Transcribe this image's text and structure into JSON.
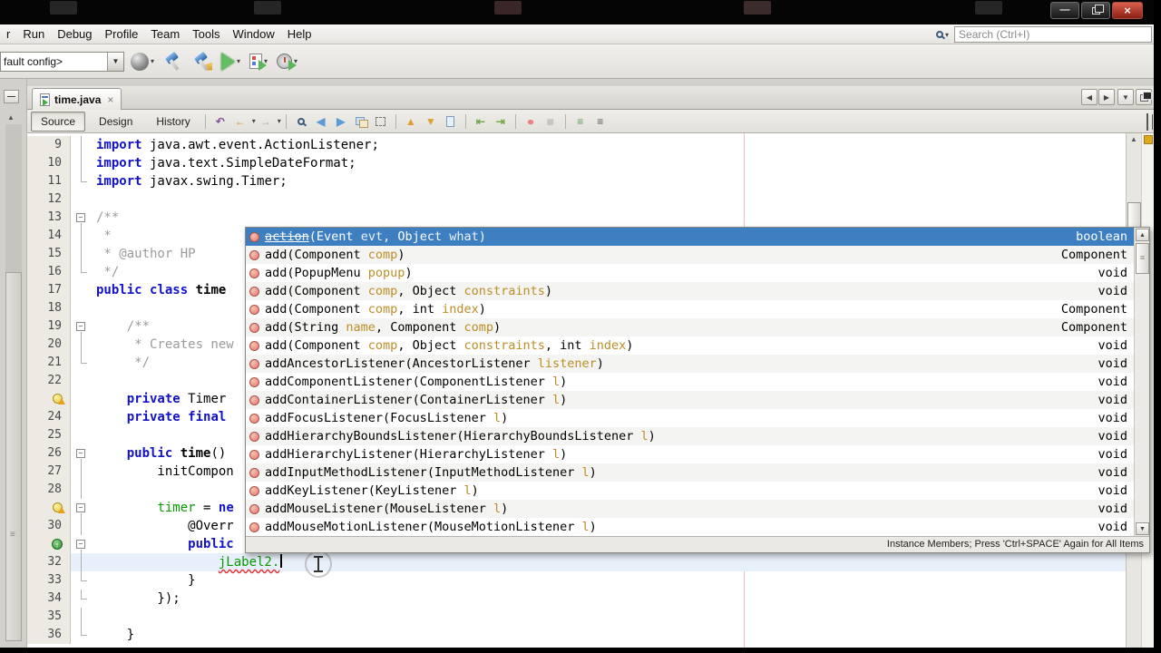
{
  "window": {
    "min_label": "—",
    "close_label": "×"
  },
  "menu_bar": {
    "items": [
      "r",
      "Run",
      "Debug",
      "Profile",
      "Team",
      "Tools",
      "Window",
      "Help"
    ],
    "search_placeholder": "Search (Ctrl+I)"
  },
  "toolbar": {
    "config_value": "fault config>"
  },
  "tabs": {
    "active_label": "time.java"
  },
  "view_buttons": [
    "Source",
    "Design",
    "History"
  ],
  "icons": {
    "combo-arrow": "▼",
    "dropdown": "▾",
    "close-tab": "×",
    "last-edit": "↶",
    "jump-back": "←",
    "jump-forward": "→",
    "find-prev": "◀",
    "find-next": "▶",
    "prev-occurrence": "▲",
    "next-occurrence": "▼",
    "shift-left": "⇤",
    "shift-right": "⇥",
    "record-macro": "●",
    "stop-macro": "■",
    "comment": "≡",
    "uncomment": "≡",
    "tab-nav-left": "◀",
    "tab-nav-right": "▶",
    "tab-list": "▼",
    "scroll-up": "▲",
    "scroll-down": "▼",
    "grip": "≡",
    "panel-min": "—",
    "override-arrow": "↑",
    "fold-minus": "−"
  },
  "code": {
    "lines": [
      {
        "n": "9",
        "f": "line",
        "s": [
          [
            "k",
            "import"
          ],
          [
            "p",
            " java.awt.event.ActionListener;"
          ]
        ]
      },
      {
        "n": "10",
        "f": "line",
        "s": [
          [
            "k",
            "import"
          ],
          [
            "p",
            " java.text.SimpleDateFormat;"
          ]
        ]
      },
      {
        "n": "11",
        "f": "end",
        "s": [
          [
            "k",
            "import"
          ],
          [
            "p",
            " javax.swing.Timer;"
          ]
        ]
      },
      {
        "n": "12",
        "f": "",
        "s": []
      },
      {
        "n": "13",
        "f": "minus",
        "s": [
          [
            "c",
            "/**"
          ]
        ]
      },
      {
        "n": "14",
        "f": "line",
        "s": [
          [
            "c",
            " *"
          ]
        ]
      },
      {
        "n": "15",
        "f": "line",
        "s": [
          [
            "c",
            " * @author HP"
          ]
        ]
      },
      {
        "n": "16",
        "f": "end",
        "s": [
          [
            "c",
            " */"
          ]
        ]
      },
      {
        "n": "17",
        "f": "",
        "s": [
          [
            "k",
            "public"
          ],
          [
            "p",
            " "
          ],
          [
            "k",
            "class"
          ],
          [
            "p",
            " "
          ],
          [
            "b",
            "time"
          ]
        ]
      },
      {
        "n": "18",
        "f": "",
        "s": []
      },
      {
        "n": "19",
        "f": "minus",
        "s": [
          [
            "c",
            "    /**"
          ]
        ]
      },
      {
        "n": "20",
        "f": "line",
        "s": [
          [
            "c",
            "     * Creates new"
          ]
        ]
      },
      {
        "n": "21",
        "f": "end",
        "s": [
          [
            "c",
            "     */"
          ]
        ]
      },
      {
        "n": "22",
        "f": "",
        "s": []
      },
      {
        "n": "23",
        "g": "bulb",
        "f": "",
        "s": [
          [
            "p",
            "    "
          ],
          [
            "k",
            "private"
          ],
          [
            "p",
            " Timer"
          ]
        ]
      },
      {
        "n": "24",
        "f": "",
        "s": [
          [
            "p",
            "    "
          ],
          [
            "k",
            "private"
          ],
          [
            "p",
            " "
          ],
          [
            "k",
            "final"
          ]
        ]
      },
      {
        "n": "25",
        "f": "",
        "s": []
      },
      {
        "n": "26",
        "f": "minus",
        "s": [
          [
            "p",
            "    "
          ],
          [
            "k",
            "public"
          ],
          [
            "p",
            " "
          ],
          [
            "b",
            "time"
          ],
          [
            "p",
            "()"
          ]
        ]
      },
      {
        "n": "27",
        "f": "line",
        "s": [
          [
            "p",
            "        initCompon"
          ]
        ]
      },
      {
        "n": "28",
        "f": "line",
        "s": []
      },
      {
        "n": "29",
        "g": "bulb",
        "f": "minus",
        "s": [
          [
            "p",
            "        "
          ],
          [
            "f",
            "timer"
          ],
          [
            "p",
            " = "
          ],
          [
            "k",
            "ne"
          ]
        ]
      },
      {
        "n": "30",
        "f": "line",
        "s": [
          [
            "p",
            "            @Overr"
          ]
        ]
      },
      {
        "n": "31",
        "g": "ovr",
        "f": "minus",
        "s": [
          [
            "p",
            "            "
          ],
          [
            "k",
            "public"
          ]
        ]
      },
      {
        "n": "32",
        "f": "line",
        "cur": true,
        "caret": true,
        "s": [
          [
            "p",
            "                "
          ],
          [
            "e",
            "jLabel2."
          ]
        ]
      },
      {
        "n": "33",
        "f": "end",
        "s": [
          [
            "p",
            "            }"
          ]
        ]
      },
      {
        "n": "34",
        "f": "end",
        "s": [
          [
            "p",
            "        });"
          ]
        ]
      },
      {
        "n": "35",
        "f": "line",
        "s": []
      },
      {
        "n": "36",
        "f": "end",
        "s": [
          [
            "p",
            "    }"
          ]
        ]
      }
    ]
  },
  "popup": {
    "hint": "Instance Members; Press 'Ctrl+SPACE' Again for All Items",
    "items": [
      {
        "name": "action",
        "dep": true,
        "sel": true,
        "ret": "boolean",
        "sig": [
          [
            "(Event ",
            0
          ],
          [
            "evt",
            1
          ],
          [
            ", Object ",
            0
          ],
          [
            "what",
            1
          ],
          [
            ")",
            0
          ]
        ]
      },
      {
        "name": "add",
        "ret": "Component",
        "sig": [
          [
            "(Component ",
            0
          ],
          [
            "comp",
            1
          ],
          [
            ")",
            0
          ]
        ]
      },
      {
        "name": "add",
        "ret": "void",
        "sig": [
          [
            "(PopupMenu ",
            0
          ],
          [
            "popup",
            1
          ],
          [
            ")",
            0
          ]
        ]
      },
      {
        "name": "add",
        "ret": "void",
        "sig": [
          [
            "(Component ",
            0
          ],
          [
            "comp",
            1
          ],
          [
            ", Object ",
            0
          ],
          [
            "constraints",
            1
          ],
          [
            ")",
            0
          ]
        ]
      },
      {
        "name": "add",
        "ret": "Component",
        "sig": [
          [
            "(Component ",
            0
          ],
          [
            "comp",
            1
          ],
          [
            ", int ",
            0
          ],
          [
            "index",
            1
          ],
          [
            ")",
            0
          ]
        ]
      },
      {
        "name": "add",
        "ret": "Component",
        "sig": [
          [
            "(String ",
            0
          ],
          [
            "name",
            1
          ],
          [
            ", Component ",
            0
          ],
          [
            "comp",
            1
          ],
          [
            ")",
            0
          ]
        ]
      },
      {
        "name": "add",
        "ret": "void",
        "sig": [
          [
            "(Component ",
            0
          ],
          [
            "comp",
            1
          ],
          [
            ", Object ",
            0
          ],
          [
            "constraints",
            1
          ],
          [
            ", int ",
            0
          ],
          [
            "index",
            1
          ],
          [
            ")",
            0
          ]
        ]
      },
      {
        "name": "addAncestorListener",
        "ret": "void",
        "sig": [
          [
            "(AncestorListener ",
            0
          ],
          [
            "listener",
            1
          ],
          [
            ")",
            0
          ]
        ]
      },
      {
        "name": "addComponentListener",
        "ret": "void",
        "sig": [
          [
            "(ComponentListener ",
            0
          ],
          [
            "l",
            1
          ],
          [
            ")",
            0
          ]
        ]
      },
      {
        "name": "addContainerListener",
        "ret": "void",
        "sig": [
          [
            "(ContainerListener ",
            0
          ],
          [
            "l",
            1
          ],
          [
            ")",
            0
          ]
        ]
      },
      {
        "name": "addFocusListener",
        "ret": "void",
        "sig": [
          [
            "(FocusListener ",
            0
          ],
          [
            "l",
            1
          ],
          [
            ")",
            0
          ]
        ]
      },
      {
        "name": "addHierarchyBoundsListener",
        "ret": "void",
        "sig": [
          [
            "(HierarchyBoundsListener ",
            0
          ],
          [
            "l",
            1
          ],
          [
            ")",
            0
          ]
        ]
      },
      {
        "name": "addHierarchyListener",
        "ret": "void",
        "sig": [
          [
            "(HierarchyListener ",
            0
          ],
          [
            "l",
            1
          ],
          [
            ")",
            0
          ]
        ]
      },
      {
        "name": "addInputMethodListener",
        "ret": "void",
        "sig": [
          [
            "(InputMethodListener ",
            0
          ],
          [
            "l",
            1
          ],
          [
            ")",
            0
          ]
        ]
      },
      {
        "name": "addKeyListener",
        "ret": "void",
        "sig": [
          [
            "(KeyListener ",
            0
          ],
          [
            "l",
            1
          ],
          [
            ")",
            0
          ]
        ]
      },
      {
        "name": "addMouseListener",
        "ret": "void",
        "sig": [
          [
            "(MouseListener ",
            0
          ],
          [
            "l",
            1
          ],
          [
            ")",
            0
          ]
        ]
      },
      {
        "name": "addMouseMotionListener",
        "ret": "void",
        "sig": [
          [
            "(MouseMotionListener ",
            0
          ],
          [
            "l",
            1
          ],
          [
            ")",
            0
          ]
        ]
      }
    ]
  }
}
